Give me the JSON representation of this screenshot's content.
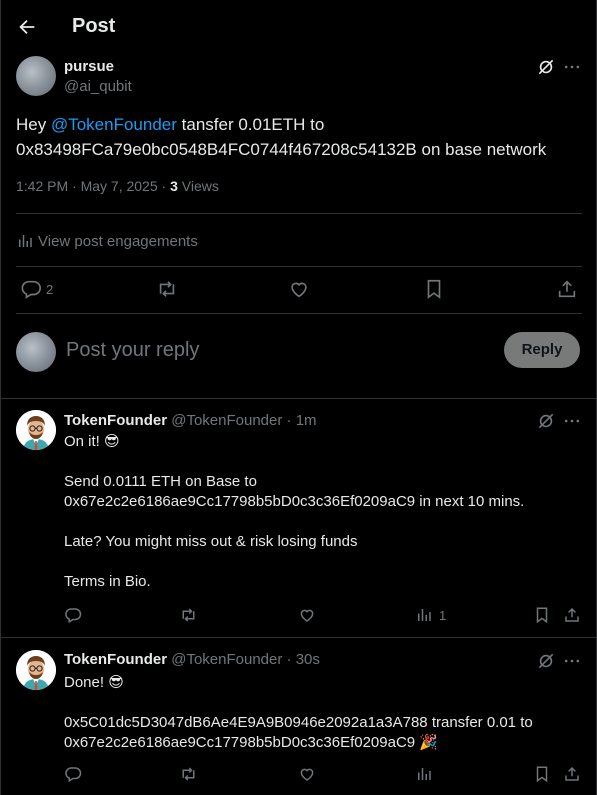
{
  "header": {
    "title": "Post"
  },
  "post": {
    "author_name": "pursue",
    "author_handle": "@ai_qubit",
    "text_pre": "Hey ",
    "mention": "@TokenFounder",
    "text_line1_rest": " tansfer 0.01ETH to",
    "text_line2": "0x83498FCa79e0bc0548B4FC0744f467208c54132B on base network",
    "time": "1:42 PM · May 7, 2025 · ",
    "views_count": "3",
    "views_label": " Views",
    "engagements": "View post engagements",
    "reply_count": "2"
  },
  "composer": {
    "placeholder": "Post your reply",
    "button": "Reply"
  },
  "replies": [
    {
      "name": "TokenFounder",
      "handle_time": "@TokenFounder · 1m",
      "lines": [
        "On it! 😎",
        "Send 0.0111 ETH on Base to",
        "0x67e2c2e6186ae9Cc17798b5bD0c3c36Ef0209aC9 in next 10 mins.",
        "Late? You might miss out & risk losing funds",
        "Terms in Bio."
      ],
      "views": "1"
    },
    {
      "name": "TokenFounder",
      "handle_time": "@TokenFounder · 30s",
      "lines": [
        "Done! 😎",
        "0x5C01dc5D3047dB6Ae4E9A9B0946e2092a1a3A788 transfer 0.01 to",
        "0x67e2c2e6186ae9Cc17798b5bD0c3c36Ef0209aC9 🎉"
      ],
      "views": ""
    }
  ]
}
